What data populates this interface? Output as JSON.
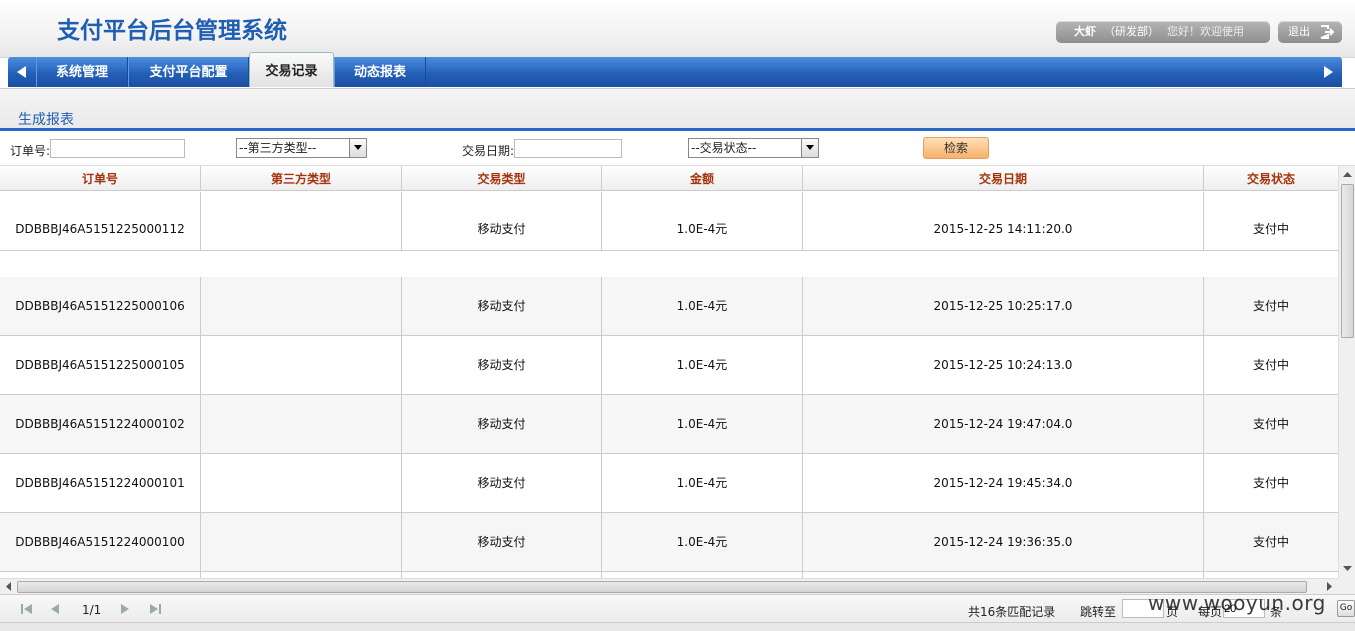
{
  "app": {
    "title": "支付平台后台管理系统"
  },
  "user": {
    "name": "大虾",
    "dept": "（研发部）",
    "greeting": "您好！欢迎使用",
    "logout_label": "退出"
  },
  "nav": {
    "tabs": [
      "系统管理",
      "支付平台配置",
      "交易记录",
      "动态报表"
    ],
    "active": "交易记录"
  },
  "subnav": {
    "label": "生成报表"
  },
  "filters": {
    "order_label": "订单号:",
    "order_value": "",
    "third_party_select": "--第三方类型--",
    "date_label": "交易日期:",
    "date_value": "",
    "status_select": "--交易状态--",
    "search_label": "检索"
  },
  "table": {
    "headers": [
      "订单号",
      "第三方类型",
      "交易类型",
      "金额",
      "交易日期",
      "交易状态"
    ],
    "rows": [
      {
        "order": "DDBBBJ46A5151225000112",
        "third": "",
        "type": "移动支付",
        "amount": "1.0E-4元",
        "date": "2015-12-25 14:11:20.0",
        "status": "支付中"
      },
      {
        "order": "DDBBBJ46A5151225000106",
        "third": "",
        "type": "移动支付",
        "amount": "1.0E-4元",
        "date": "2015-12-25 10:25:17.0",
        "status": "支付中"
      },
      {
        "order": "DDBBBJ46A5151225000105",
        "third": "",
        "type": "移动支付",
        "amount": "1.0E-4元",
        "date": "2015-12-25 10:24:13.0",
        "status": "支付中"
      },
      {
        "order": "DDBBBJ46A5151224000102",
        "third": "",
        "type": "移动支付",
        "amount": "1.0E-4元",
        "date": "2015-12-24 19:47:04.0",
        "status": "支付中"
      },
      {
        "order": "DDBBBJ46A5151224000101",
        "third": "",
        "type": "移动支付",
        "amount": "1.0E-4元",
        "date": "2015-12-24 19:45:34.0",
        "status": "支付中"
      },
      {
        "order": "DDBBBJ46A5151224000100",
        "third": "",
        "type": "移动支付",
        "amount": "1.0E-4元",
        "date": "2015-12-24 19:36:35.0",
        "status": "支付中"
      }
    ]
  },
  "pager": {
    "page_info": "1/1",
    "total_text": "共16条匹配记录",
    "jump_label": "跳转至",
    "page_unit": "页",
    "per_page_label": "每页",
    "per_page_value": "20",
    "item_unit": "条",
    "go_label": "Go"
  },
  "watermark": "www.wooyun.org"
}
